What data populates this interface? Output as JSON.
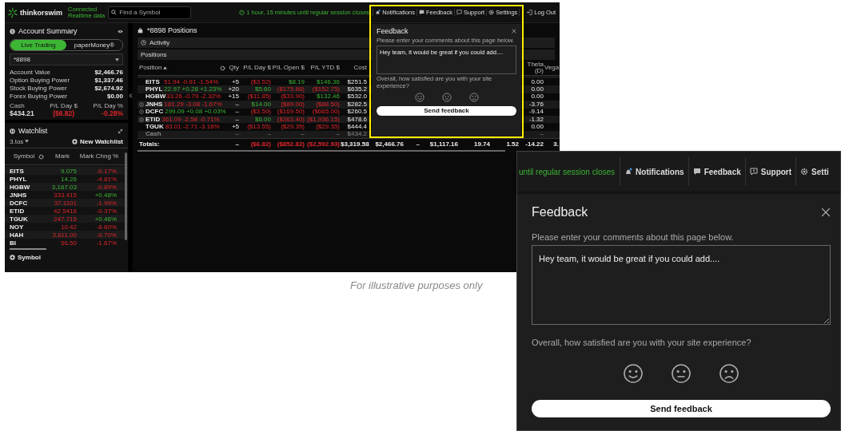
{
  "topbar": {
    "logo_text": "thinkorswim",
    "connection": "Connected",
    "data_feed": "Realtime data",
    "search_placeholder": "Find a Symbol",
    "session_timer": "1 hour, 15 minutes until regular session closes",
    "nav": [
      {
        "label": "Notifications",
        "kind": "bell"
      },
      {
        "label": "Feedback",
        "kind": "chat"
      },
      {
        "label": "Support",
        "kind": "help"
      },
      {
        "label": "Settings",
        "kind": "gear"
      },
      {
        "label": "Log Out",
        "kind": "logout"
      }
    ]
  },
  "account": {
    "title": "Account Summary",
    "modes": [
      {
        "label": "Live Trading",
        "selected": true
      },
      {
        "label": "paperMoney®",
        "selected": false
      }
    ],
    "account_number": "*8898",
    "metrics": [
      {
        "label": "Account Value",
        "value": "$2,466.76"
      },
      {
        "label": "Option Buying Power",
        "value": "$1,337.46"
      },
      {
        "label": "Stock Buying Power",
        "value": "$2,674.92"
      },
      {
        "label": "Forex Buying Power",
        "value": "$0.00"
      }
    ],
    "summary": [
      {
        "label": "Cash",
        "value": "$434.21"
      },
      {
        "label": "P/L Day $",
        "value": "($6.82)",
        "gain": false
      },
      {
        "label": "P/L Day %",
        "value": "-0.28%",
        "gain": false
      }
    ]
  },
  "watchlist": {
    "title": "Watchlist",
    "list_name": "3.tos",
    "new_button": "New Watchlist",
    "columns": [
      "Symbol",
      "Mark",
      "Mark Chng %"
    ],
    "rows": [
      {
        "symbol": "EITS",
        "mark": "9.075",
        "mark_gain": true,
        "change": "-0.17%",
        "change_gain": false
      },
      {
        "symbol": "PHYL",
        "mark": "14.26",
        "mark_gain": true,
        "change": "-4.81%",
        "change_gain": false
      },
      {
        "symbol": "HGBW",
        "mark": "3,167.03",
        "mark_gain": true,
        "change": "-0.89%",
        "change_gain": false
      },
      {
        "symbol": "JNHS",
        "mark": "333.415",
        "mark_gain": false,
        "change": "+0.48%",
        "change_gain": true
      },
      {
        "symbol": "DCFC",
        "mark": "37.1101",
        "mark_gain": false,
        "change": "-1.99%",
        "change_gain": false
      },
      {
        "symbol": "ETID",
        "mark": "42.5416",
        "mark_gain": false,
        "change": "-0.37%",
        "change_gain": false
      },
      {
        "symbol": "TGUK",
        "mark": "247.715",
        "mark_gain": false,
        "change": "+0.46%",
        "change_gain": true
      },
      {
        "symbol": "NOY",
        "mark": "10.42",
        "mark_gain": false,
        "change": "-8.60%",
        "change_gain": false
      },
      {
        "symbol": "HAH",
        "mark": "3,611.00",
        "mark_gain": false,
        "change": "-0.70%",
        "change_gain": false
      },
      {
        "symbol": "BI",
        "mark": "56.50",
        "mark_gain": false,
        "change": "-1.67%",
        "change_gain": false
      }
    ],
    "add_symbol": "Symbol"
  },
  "positions": {
    "title": "*8898 Positions",
    "activity": "Activity",
    "section": "Positions",
    "columns": {
      "position": "Position",
      "qty": "Qty",
      "pl_day": "P/L Day $",
      "pl_open": "P/L Open $",
      "pl_ytd": "P/L YTD $",
      "cost": "Cost",
      "theta": "Theta (D)",
      "vega": "Vega"
    },
    "rows": [
      {
        "kind": "stock",
        "symbol": "EITS",
        "quote": "51.94 -0.81 -1.54%",
        "quote_gain": false,
        "qty": "+5",
        "pl_day": {
          "t": "($3.52)",
          "gain": false
        },
        "pl_open": {
          "t": "$8.19",
          "gain": true
        },
        "pl_ytd": {
          "t": "$146.36",
          "gain": true
        },
        "cost": "$251.5",
        "theta": "0.00"
      },
      {
        "kind": "stock",
        "symbol": "PHYL",
        "quote": "22.97 +0.28 +1.23%",
        "quote_gain": true,
        "qty": "+20",
        "pl_day": {
          "t": "$5.60",
          "gain": true
        },
        "pl_open": {
          "t": "($175.86)",
          "gain": false
        },
        "pl_ytd": {
          "t": "($152.75)",
          "gain": false
        },
        "cost": "$635.2",
        "theta": "0.00"
      },
      {
        "kind": "stock",
        "symbol": "HGBW",
        "quote": "33.26 -0.79 -2.32%",
        "quote_gain": false,
        "qty": "+15",
        "pl_day": {
          "t": "($11.85)",
          "gain": false
        },
        "pl_open": {
          "t": "($33.90)",
          "gain": false
        },
        "pl_ytd": {
          "t": "$132.46",
          "gain": true
        },
        "cost": "$532.0",
        "theta": "0.00"
      },
      {
        "kind": "option",
        "symbol": "JNHS",
        "quote": "181.29 -3.08 -1.67%",
        "quote_gain": false,
        "qty": "–",
        "pl_day": {
          "t": "$14.00",
          "gain": true
        },
        "pl_open": {
          "t": "($89.00)",
          "gain": false
        },
        "pl_ytd": {
          "t": "($88.50)",
          "gain": false
        },
        "cost": "$282.5",
        "theta": "-3.76"
      },
      {
        "kind": "option",
        "symbol": "DCFC",
        "quote": "299.09 +0.08 +0.03%",
        "quote_gain": true,
        "qty": "–",
        "pl_day": {
          "t": "($3.50)",
          "gain": false
        },
        "pl_open": {
          "t": "($169.50)",
          "gain": false
        },
        "pl_ytd": {
          "t": "($665.00)",
          "gain": false
        },
        "cost": "$260.5",
        "theta": "-9.14"
      },
      {
        "kind": "option",
        "symbol": "ETID",
        "quote": "361.09 -2.58 -0.71%",
        "quote_gain": false,
        "qty": "–",
        "pl_day": {
          "t": "$6.00",
          "gain": true
        },
        "pl_open": {
          "t": "($363.40)",
          "gain": false
        },
        "pl_ytd": {
          "t": "($1,936.15)",
          "gain": false
        },
        "cost": "$478.6",
        "theta": "-1.32"
      },
      {
        "kind": "stock",
        "symbol": "TGUK",
        "quote": "83.01 -2.71 -3.16%",
        "quote_gain": false,
        "qty": "+5",
        "pl_day": {
          "t": "($13.55)",
          "gain": false
        },
        "pl_open": {
          "t": "($29.35)",
          "gain": false
        },
        "pl_ytd": {
          "t": "($29.35)",
          "gain": false
        },
        "cost": "$444.4",
        "theta": "0.00"
      },
      {
        "kind": "cash",
        "symbol": "Cash",
        "qty": "–",
        "pl_day": {
          "t": "–"
        },
        "pl_open": {
          "t": "–"
        },
        "pl_ytd": {
          "t": "–"
        },
        "cost": "$434.2",
        "theta": "–"
      }
    ],
    "totals": {
      "label": "Totals:",
      "qty": "–",
      "pl_day": {
        "t": "($6.82)",
        "gain": false
      },
      "pl_open": {
        "t": "($852.82)",
        "gain": false
      },
      "pl_ytd": {
        "t": "($2,592.93)",
        "gain": false
      },
      "cost": "$3,319.58",
      "column_7": "$2,466.76",
      "column_8": "–",
      "column_9": "$1,117.16",
      "column_10": "19.74",
      "column_11": "1.52",
      "theta": "-14.22",
      "vega": "3."
    }
  },
  "feedback_popup": {
    "title": "Feedback",
    "prompt": "Please enter your comments about this page below.",
    "value": "Hey team, it would be great if you could add....",
    "question": "Overall, how satisfied are you with your site experience?",
    "button": "Send feedback"
  },
  "caption": "For illustrative purposes only",
  "zoomed_inset": {
    "session_timer": "until regular session closes",
    "nav": [
      {
        "label": "Notifications",
        "kind": "bell"
      },
      {
        "label": "Feedback",
        "kind": "chat"
      },
      {
        "label": "Support",
        "kind": "help"
      },
      {
        "label": "Setti",
        "kind": "gear"
      }
    ],
    "title": "Feedback",
    "prompt": "Please enter your comments about this page below.",
    "value": "Hey team, it would be great if you could add....",
    "question": "Overall, how satisfied are you with your site experience?",
    "button": "Send feedback"
  }
}
